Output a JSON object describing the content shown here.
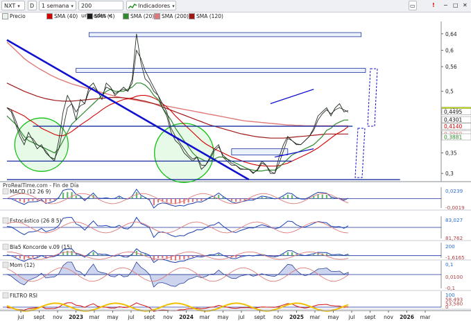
{
  "toolbar": {
    "symbol": "NXT",
    "period": "1 semana",
    "units": "200 unidades",
    "indicators": "Indicadores",
    "window_buttons": [
      "▭",
      "−",
      "□",
      "✕"
    ]
  },
  "legend": [
    {
      "label": "Precio",
      "color": "#2f7a2f"
    },
    {
      "label": "SMA (40)",
      "color": "#d40000"
    },
    {
      "label": "SMA (4)",
      "color": "#1a1a1a"
    },
    {
      "label": "SMA (20)",
      "color": "#2e8b2e"
    },
    {
      "label": "SMA (200)",
      "color": "#e07a7a"
    },
    {
      "label": "SMA (120)",
      "color": "#a01818"
    }
  ],
  "source_label": "ProRealTime.com - Fin de Día",
  "colors": {
    "price": "#1f2f1f",
    "sma40": "#d40000",
    "sma4": "#1a1a1a",
    "sma20": "#2e8b2e",
    "sma200": "#e07a7a",
    "sma120": "#a01818",
    "trendline": "#1010d0",
    "circle": "#10c010",
    "zone_fill": "#dce8f8",
    "zone_stroke": "#1a2fa0"
  },
  "chart_data": {
    "type": "line",
    "x_labels": [
      "jul",
      "sept",
      "nov",
      "2023",
      "mar",
      "may",
      "jul",
      "sept",
      "nov",
      "2024",
      "mar",
      "may",
      "jul",
      "sept",
      "nov",
      "2025",
      "mar",
      "may",
      "jul",
      "sept",
      "nov",
      "2026",
      "mar"
    ],
    "ylim": [
      0.28,
      0.67
    ],
    "yticks": [
      "0,64",
      "0,6",
      "0,56",
      "0,5",
      "0,45",
      "0,4",
      "0,35",
      "0,3"
    ],
    "price_labels": [
      {
        "text": "0,453",
        "value": 0.453,
        "color": "#c8e800"
      },
      {
        "text": "0,4495",
        "value": 0.4495,
        "color": "#ffffff"
      },
      {
        "text": "0,4301",
        "value": 0.4301,
        "color": "#ffffff"
      },
      {
        "text": "0,4140",
        "value": 0.414,
        "color": "#ffffff",
        "text_color": "#d40000"
      },
      {
        "text": "0,3960",
        "value": 0.396,
        "color": "#ffffff",
        "text_color": "#e07a7a"
      },
      {
        "text": "0,3881",
        "value": 0.3881,
        "color": "#ffffff",
        "text_color": "#2e8b2e"
      }
    ],
    "series": [
      {
        "name": "Precio",
        "values": [
          0.46,
          0.45,
          0.42,
          0.39,
          0.37,
          0.4,
          0.38,
          0.36,
          0.37,
          0.35,
          0.34,
          0.33,
          0.38,
          0.45,
          0.49,
          0.47,
          0.43,
          0.48,
          0.47,
          0.51,
          0.52,
          0.5,
          0.48,
          0.52,
          0.51,
          0.49,
          0.5,
          0.51,
          0.5,
          0.53,
          0.64,
          0.57,
          0.53,
          0.52,
          0.5,
          0.49,
          0.46,
          0.44,
          0.4,
          0.38,
          0.37,
          0.35,
          0.34,
          0.33,
          0.34,
          0.31,
          0.32,
          0.34,
          0.36,
          0.37,
          0.34,
          0.33,
          0.32,
          0.32,
          0.31,
          0.31,
          0.31,
          0.3,
          0.31,
          0.33,
          0.32,
          0.3,
          0.3,
          0.34,
          0.37,
          0.39,
          0.38,
          0.37,
          0.37,
          0.38,
          0.39,
          0.41,
          0.44,
          0.45,
          0.46,
          0.44,
          0.46,
          0.47,
          0.45,
          0.453
        ]
      },
      {
        "name": "SMA (4)",
        "values": [
          0.46,
          0.455,
          0.43,
          0.4,
          0.38,
          0.39,
          0.385,
          0.37,
          0.365,
          0.355,
          0.34,
          0.335,
          0.36,
          0.41,
          0.46,
          0.47,
          0.45,
          0.465,
          0.47,
          0.5,
          0.51,
          0.5,
          0.49,
          0.51,
          0.505,
          0.495,
          0.5,
          0.505,
          0.5,
          0.52,
          0.6,
          0.58,
          0.55,
          0.53,
          0.51,
          0.49,
          0.47,
          0.45,
          0.41,
          0.39,
          0.375,
          0.36,
          0.345,
          0.335,
          0.34,
          0.32,
          0.32,
          0.335,
          0.355,
          0.365,
          0.345,
          0.335,
          0.325,
          0.32,
          0.312,
          0.31,
          0.31,
          0.302,
          0.307,
          0.325,
          0.32,
          0.305,
          0.3,
          0.325,
          0.355,
          0.385,
          0.38,
          0.372,
          0.37,
          0.38,
          0.39,
          0.405,
          0.43,
          0.445,
          0.455,
          0.445,
          0.455,
          0.46,
          0.455,
          0.4495
        ]
      },
      {
        "name": "SMA (20)",
        "values": [
          0.44,
          0.43,
          0.42,
          0.405,
          0.39,
          0.38,
          0.375,
          0.37,
          0.365,
          0.36,
          0.355,
          0.35,
          0.36,
          0.38,
          0.4,
          0.42,
          0.43,
          0.44,
          0.45,
          0.46,
          0.47,
          0.48,
          0.49,
          0.5,
          0.505,
          0.5,
          0.5,
          0.5,
          0.505,
          0.51,
          0.52,
          0.52,
          0.515,
          0.505,
          0.49,
          0.48,
          0.46,
          0.445,
          0.43,
          0.41,
          0.395,
          0.38,
          0.365,
          0.35,
          0.34,
          0.335,
          0.33,
          0.33,
          0.335,
          0.34,
          0.34,
          0.335,
          0.33,
          0.325,
          0.32,
          0.315,
          0.31,
          0.308,
          0.306,
          0.306,
          0.308,
          0.308,
          0.308,
          0.315,
          0.325,
          0.335,
          0.345,
          0.35,
          0.355,
          0.36,
          0.365,
          0.37,
          0.38,
          0.39,
          0.405,
          0.41,
          0.42,
          0.425,
          0.43,
          0.4301
        ]
      },
      {
        "name": "SMA (40)",
        "values": [
          0.46,
          0.455,
          0.45,
          0.445,
          0.44,
          0.432,
          0.425,
          0.418,
          0.41,
          0.405,
          0.4,
          0.395,
          0.392,
          0.392,
          0.396,
          0.402,
          0.41,
          0.418,
          0.425,
          0.432,
          0.44,
          0.447,
          0.455,
          0.462,
          0.468,
          0.472,
          0.476,
          0.48,
          0.482,
          0.484,
          0.488,
          0.49,
          0.49,
          0.488,
          0.484,
          0.478,
          0.47,
          0.462,
          0.452,
          0.44,
          0.43,
          0.42,
          0.41,
          0.4,
          0.39,
          0.38,
          0.372,
          0.366,
          0.36,
          0.355,
          0.35,
          0.345,
          0.34,
          0.336,
          0.332,
          0.328,
          0.325,
          0.322,
          0.32,
          0.319,
          0.318,
          0.318,
          0.318,
          0.319,
          0.322,
          0.325,
          0.33,
          0.335,
          0.34,
          0.345,
          0.35,
          0.356,
          0.362,
          0.37,
          0.378,
          0.386,
          0.394,
          0.4,
          0.406,
          0.414
        ]
      },
      {
        "name": "SMA (120)",
        "values": [
          0.52,
          0.515,
          0.51,
          0.505,
          0.5,
          0.496,
          0.492,
          0.488,
          0.485,
          0.482,
          0.48,
          0.478,
          0.477,
          0.476,
          0.476,
          0.476,
          0.477,
          0.478,
          0.479,
          0.48,
          0.481,
          0.482,
          0.483,
          0.484,
          0.485,
          0.485,
          0.485,
          0.484,
          0.483,
          0.482,
          0.48,
          0.478,
          0.476,
          0.473,
          0.47,
          0.466,
          0.462,
          0.458,
          0.454,
          0.45,
          0.446,
          0.442,
          0.438,
          0.434,
          0.43,
          0.426,
          0.422,
          0.418,
          0.415,
          0.412,
          0.409,
          0.406,
          0.403,
          0.4,
          0.397,
          0.395,
          0.393,
          0.391,
          0.389,
          0.388,
          0.387,
          0.386,
          0.386,
          0.386,
          0.386,
          0.387,
          0.388,
          0.389,
          0.39,
          0.391,
          0.392,
          0.393,
          0.394,
          0.395,
          0.396,
          0.396,
          0.396,
          0.396,
          0.396,
          0.396
        ]
      },
      {
        "name": "SMA (200)",
        "values": [
          0.62,
          0.61,
          0.6,
          0.59,
          0.58,
          0.572,
          0.565,
          0.558,
          0.552,
          0.546,
          0.54,
          0.535,
          0.53,
          0.526,
          0.522,
          0.518,
          0.515,
          0.512,
          0.509,
          0.506,
          0.503,
          0.5,
          0.497,
          0.494,
          0.491,
          0.488,
          0.486,
          0.484,
          0.482,
          0.48,
          0.478,
          0.476,
          0.474,
          0.472,
          0.47,
          0.468,
          0.466,
          0.464,
          0.462,
          0.46,
          0.458,
          0.456,
          0.454,
          0.452,
          0.45,
          0.448,
          0.446,
          0.444,
          0.442,
          0.44,
          0.438,
          0.436,
          0.434,
          0.432,
          0.43,
          0.428,
          0.427,
          0.426,
          0.425,
          0.424,
          0.423,
          0.422,
          0.421,
          0.42,
          0.419,
          0.418,
          0.418,
          0.417,
          0.417,
          0.416,
          0.416,
          0.416,
          0.416,
          0.416,
          0.416,
          0.416,
          0.416,
          0.416,
          0.416,
          0.416
        ]
      }
    ],
    "trendlines": [
      {
        "from": [
          0,
          0.625
        ],
        "to": [
          56,
          0.285
        ],
        "color": "#1010d0"
      },
      {
        "from": [
          6,
          0.415
        ],
        "to": [
          80,
          0.415
        ],
        "color": "#1a2fa0"
      },
      {
        "from": [
          0,
          0.285
        ],
        "to": [
          91,
          0.285
        ],
        "color": "#1a2fa0"
      },
      {
        "from": [
          0,
          0.33
        ],
        "to": [
          66,
          0.33
        ],
        "color": "#1a2fa0"
      },
      {
        "from": [
          61,
          0.47
        ],
        "to": [
          71,
          0.505
        ],
        "color": "#1010d0"
      },
      {
        "from": [
          62,
          0.34
        ],
        "to": [
          71,
          0.36
        ],
        "color": "#1010d0"
      }
    ],
    "zones": [
      {
        "from": [
          19,
          0.643
        ],
        "to": [
          82,
          0.633
        ]
      },
      {
        "from": [
          16,
          0.556
        ],
        "to": [
          83,
          0.546
        ]
      },
      {
        "from": [
          52,
          0.36
        ],
        "to": [
          65,
          0.345
        ]
      }
    ],
    "circles": [
      {
        "center": [
          8,
          0.37
        ],
        "r_val": 0.065
      },
      {
        "center": [
          41,
          0.35
        ],
        "r_val": 0.072
      }
    ]
  },
  "indicators": [
    {
      "title": "MACD (12 26 9)",
      "values": [
        "0,0239",
        "-0,0019"
      ]
    },
    {
      "title": "Estocástico (26 8 5)",
      "values": [
        "83,027",
        "81,762"
      ]
    },
    {
      "title": "Bla5 Koncorde v.09 (15)",
      "values": [
        "200",
        "-1,6165"
      ]
    },
    {
      "title": "Mom (12)",
      "values": [
        "0,1",
        "0,0100",
        "-0,1"
      ]
    },
    {
      "title": "FILTRO RSI",
      "values": [
        "100",
        "58,493",
        "53,580",
        "0"
      ]
    }
  ]
}
